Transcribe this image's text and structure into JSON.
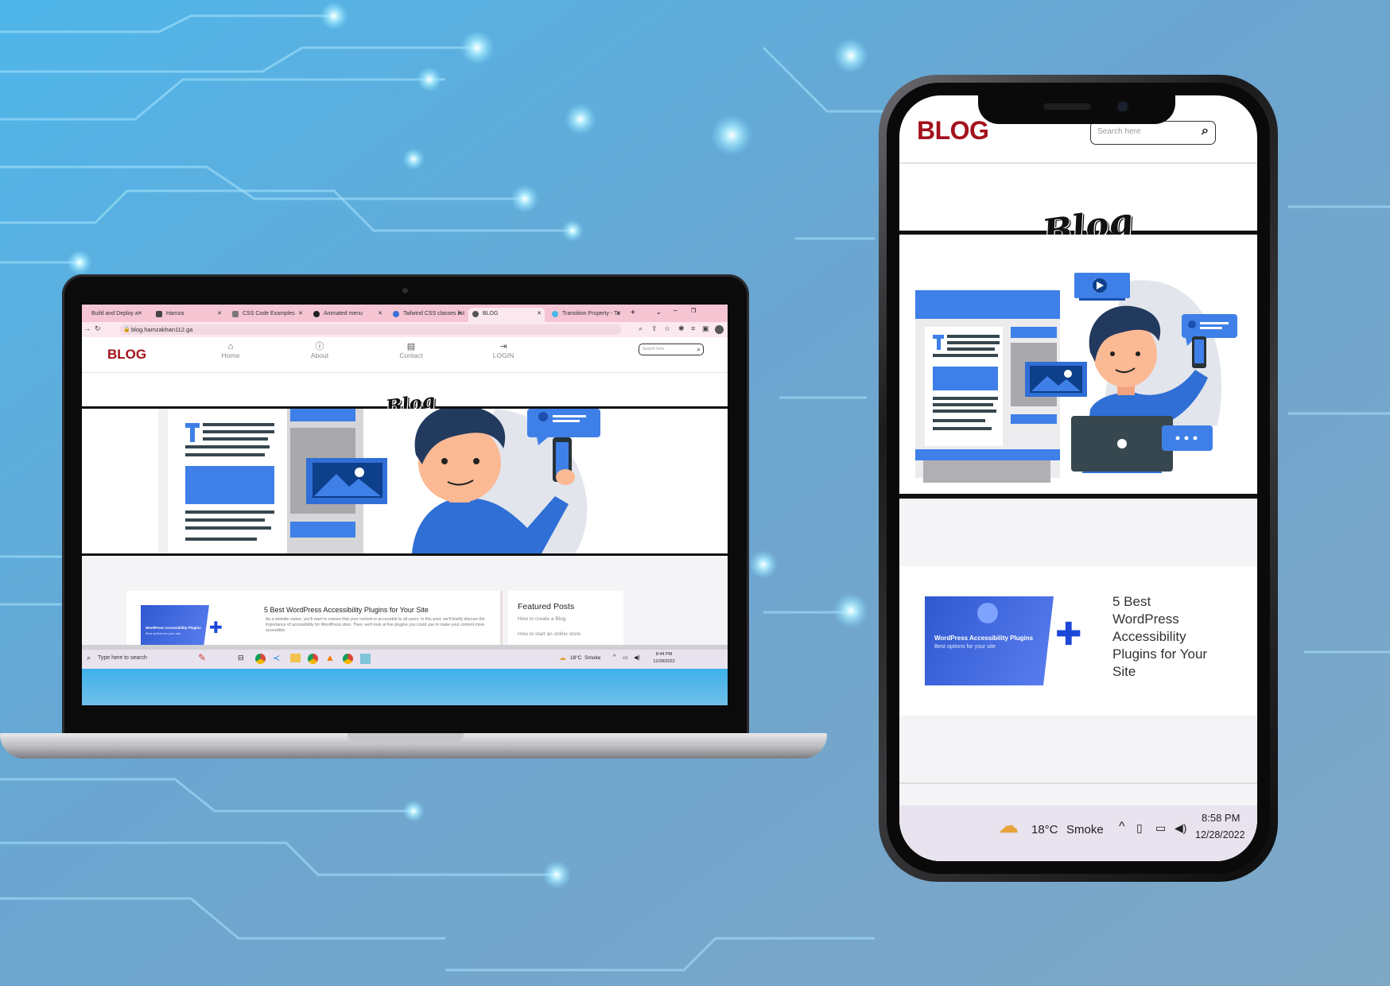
{
  "colors": {
    "brand": "#a3111c",
    "accent_blue": "#3f7fe8",
    "background": "#6aa3cf"
  },
  "browser": {
    "tabs": [
      {
        "label": "Build and Deploy a",
        "icon": "youtube-icon"
      },
      {
        "label": "Hamza",
        "icon": "github-icon"
      },
      {
        "label": "CSS Code Examples",
        "icon": "doc-icon"
      },
      {
        "label": "Animated menu",
        "icon": "codepen-icon"
      },
      {
        "label": "Tailwind CSS classes list",
        "icon": "globe-icon"
      },
      {
        "label": "BLOG",
        "icon": "globe-icon"
      },
      {
        "label": "Transition Property - Ta",
        "icon": "wind-icon"
      }
    ],
    "url": "blog.hamzakhan112.ga"
  },
  "site": {
    "logo": "BLOG",
    "nav": [
      {
        "label": "Home",
        "icon": "home-icon"
      },
      {
        "label": "About",
        "icon": "info-icon"
      },
      {
        "label": "Contact",
        "icon": "contact-card-icon"
      },
      {
        "label": "LOGIN",
        "icon": "login-icon"
      }
    ],
    "search_placeholder": "Search here",
    "hero_script": "Blog",
    "hero_card_label": "BLOG",
    "post": {
      "title": "5 Best WordPress Accessibility Plugins for Your Site",
      "excerpt": "As a website owner, you'll want to ensure that your content is accessible to all users. In this post, we'll briefly discuss the importance of accessibility for WordPress sites. Then, we'll look at five plugins you could use to make your content more accessible.",
      "thumb_title": "WordPress Accessibility Plugins",
      "thumb_subtitle": "Best options for your site"
    },
    "featured": {
      "heading": "Featured Posts",
      "items": [
        "How to create a Blog",
        "How to start an online store"
      ]
    }
  },
  "laptop_taskbar": {
    "search": "Type here to search",
    "weather": "18°C  Smoke",
    "time": "8:44 PM",
    "date": "12/28/2022"
  },
  "phone": {
    "post_title_lines": [
      "5 Best",
      "WordPress",
      "Accessibility",
      "Plugins for Your",
      "Site"
    ],
    "taskbar": {
      "weather_temp": "18°C",
      "weather_text": "Smoke",
      "time": "8:58 PM",
      "date": "12/28/2022"
    }
  }
}
